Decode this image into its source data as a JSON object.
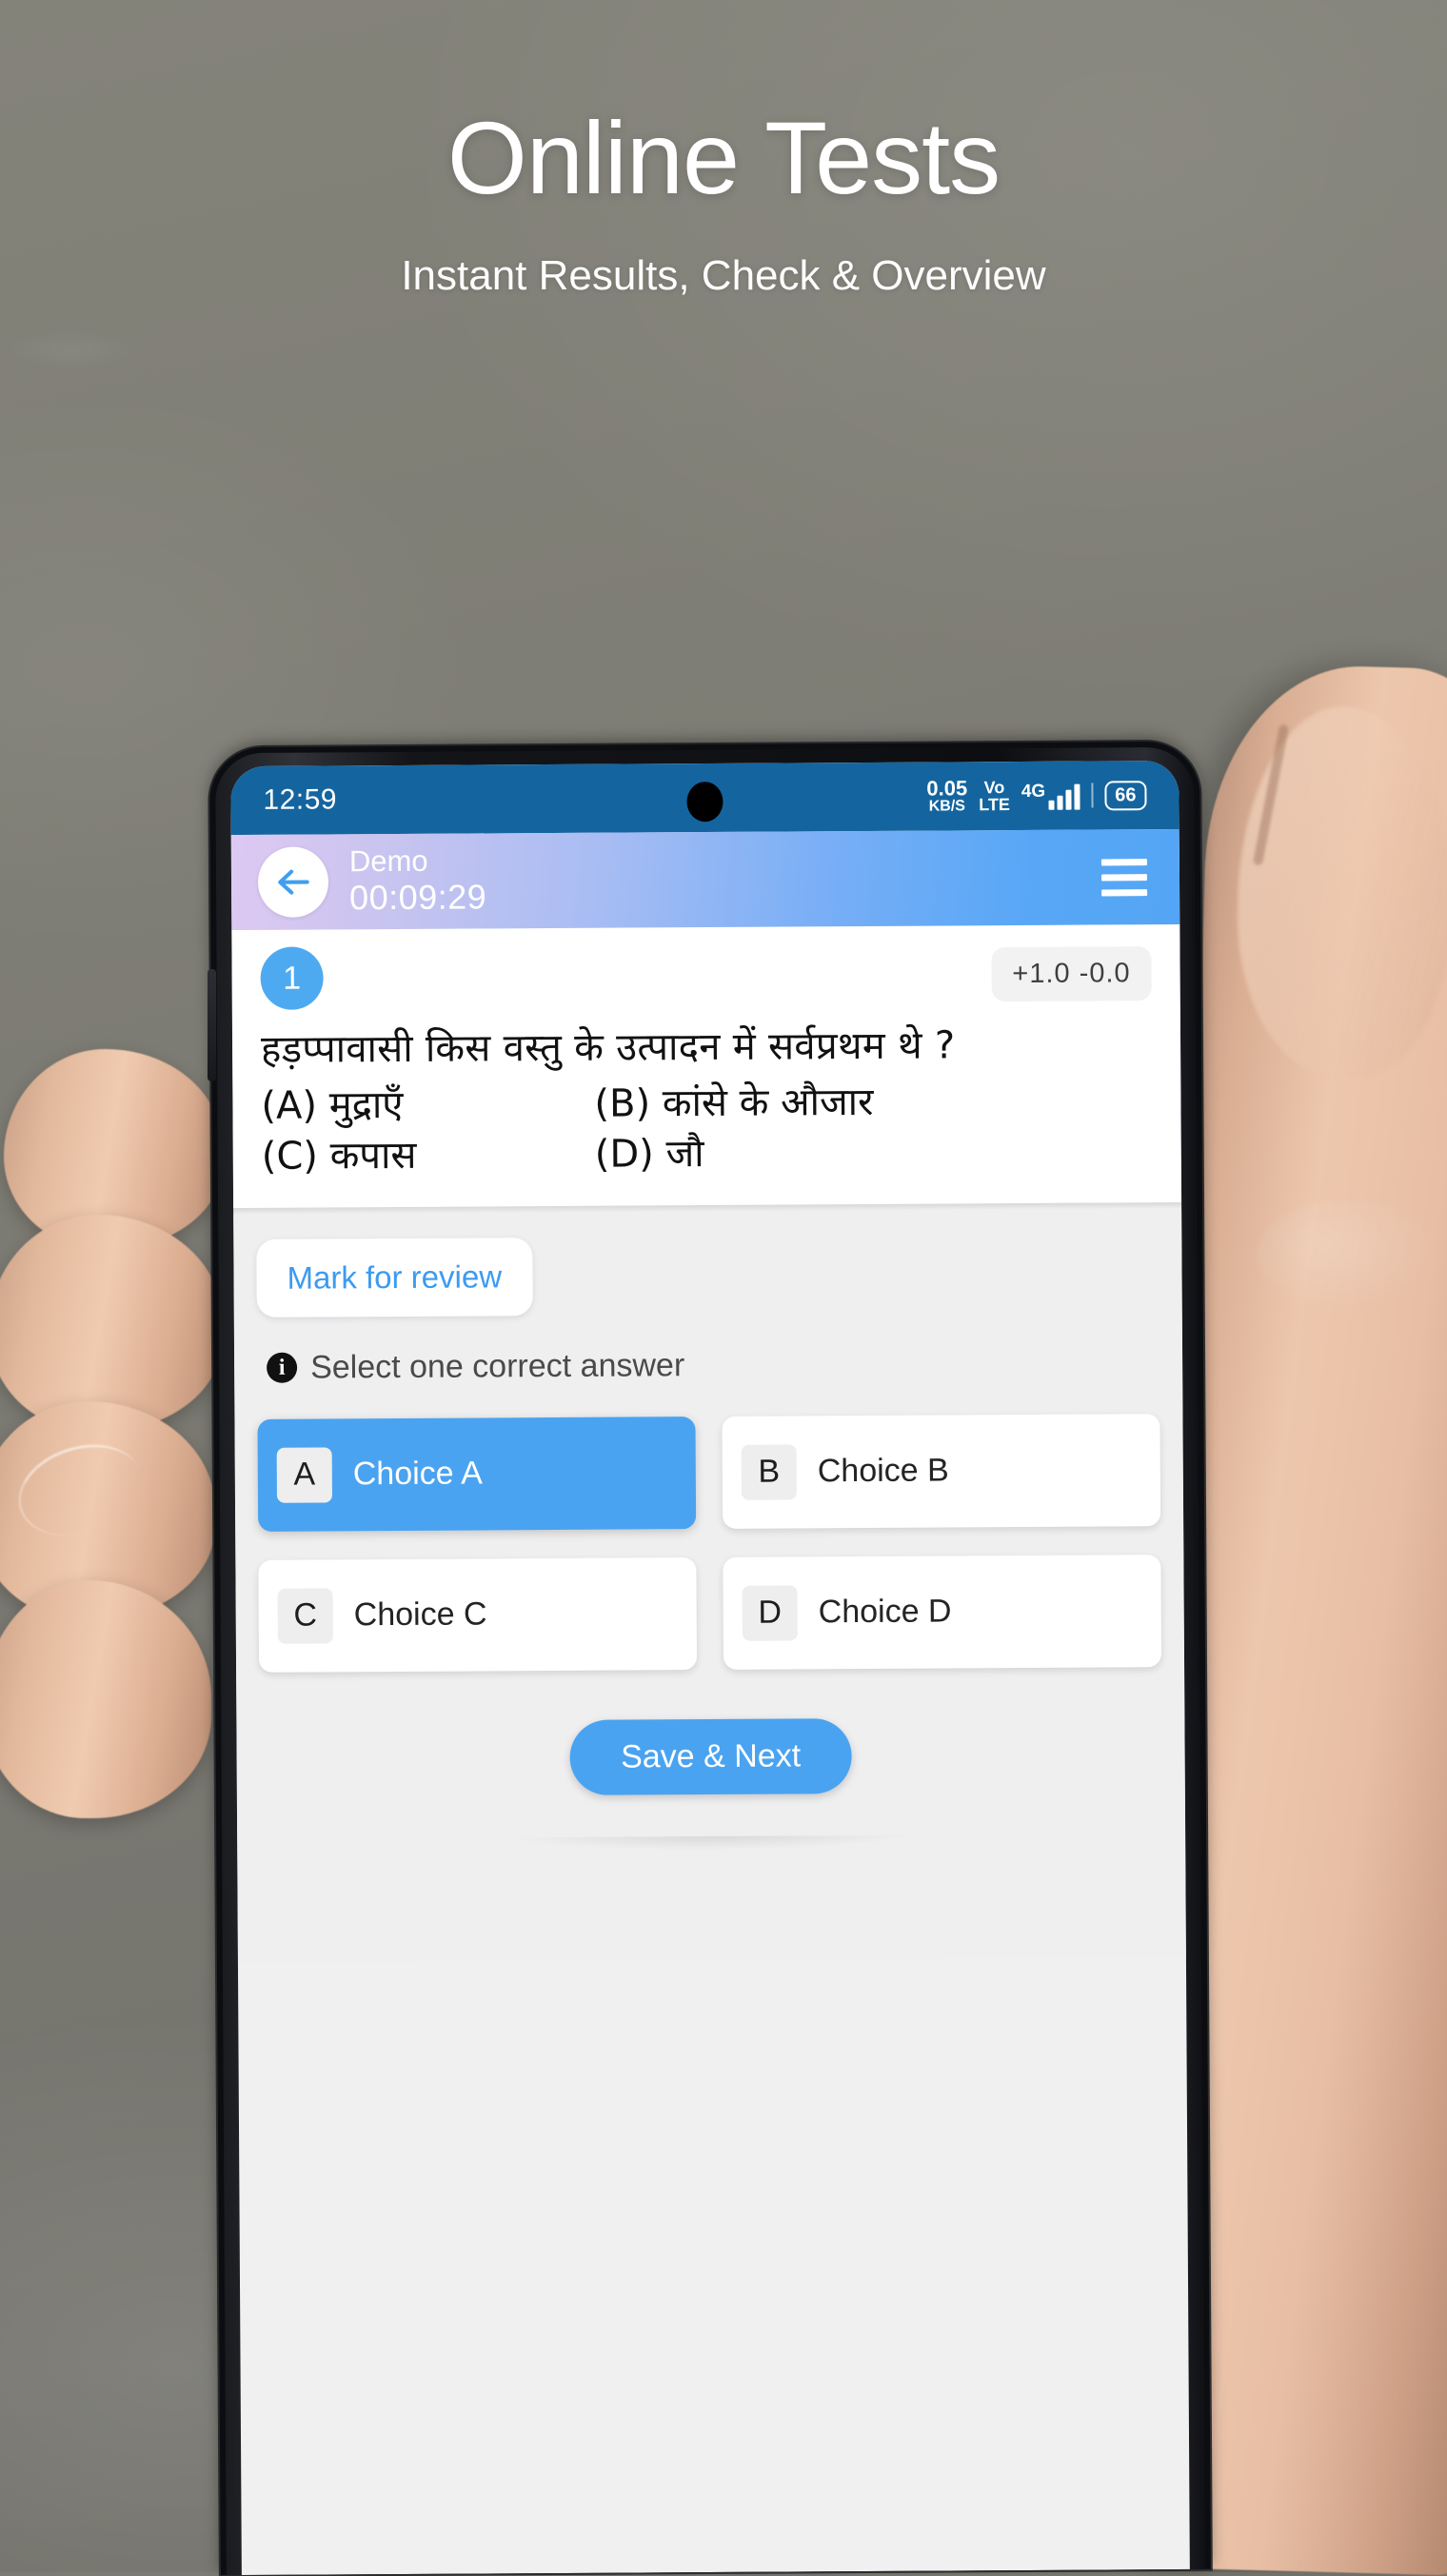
{
  "hero": {
    "title": "Online Tests",
    "subtitle": "Instant Results, Check & Overview"
  },
  "statusbar": {
    "time": "12:59",
    "net_rate": "0.05",
    "net_unit": "KB/S",
    "volte_top": "Vo",
    "volte_bottom": "LTE",
    "network": "4G",
    "battery": "66"
  },
  "appbar": {
    "title": "Demo",
    "timer": "00:09:29",
    "back_icon": "back-arrow-icon",
    "menu_icon": "hamburger-menu-icon"
  },
  "question": {
    "number": "1",
    "marks": "+1.0  -0.0",
    "text": "हड़प्पावासी किस वस्तु के उत्पादन में सर्वप्रथम थे ?",
    "option_a": "(A) मुद्राएँ",
    "option_b": "(B) कांसे के औजार",
    "option_c": "(C) कपास",
    "option_d": "(D) जौ"
  },
  "answer_area": {
    "mark_for_review": "Mark for review",
    "hint": "Select one correct answer",
    "hint_icon": "info-icon",
    "choices": [
      {
        "key": "A",
        "label": "Choice A",
        "selected": true
      },
      {
        "key": "B",
        "label": "Choice B",
        "selected": false
      },
      {
        "key": "C",
        "label": "Choice C",
        "selected": false
      },
      {
        "key": "D",
        "label": "Choice D",
        "selected": false
      }
    ],
    "save_next": "Save & Next"
  },
  "colors": {
    "background": "#7d7c74",
    "statusbar": "#14659f",
    "appbar_start": "#ddc9f2",
    "appbar_end": "#54a5f5",
    "accent_blue": "#4aa3f0",
    "link_blue": "#3c9bf0",
    "content_gray": "#efeff0",
    "card_white": "#ffffff"
  }
}
